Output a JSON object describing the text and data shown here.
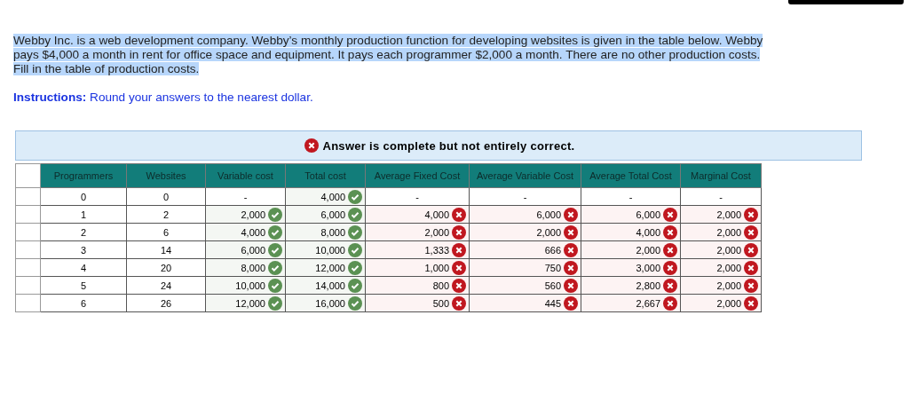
{
  "intro": {
    "text": "Webby Inc. is a web development company. Webby’s monthly production function for developing websites is given in the table below. Webby pays $4,000 a month in rent for office space and equipment. It pays each programmer $2,000 a month. There are no other production costs. Fill in the table of production costs.",
    "highlighted": true
  },
  "instructions": "**Instructions:** Round your answers to the nearest dollar.",
  "result_banner": {
    "text": "Answer is complete but not entirely correct.",
    "correct": false
  },
  "table": {
    "columns": [
      "Programmers",
      "Websites",
      "Variable cost",
      "Total cost",
      "Average Fixed Cost",
      "Average Variable Cost",
      "Average Total Cost",
      "Marginal Cost"
    ],
    "rows": [
      [
        {
          "value": "0",
          "kind": "given"
        },
        {
          "value": "0",
          "kind": "given"
        },
        {
          "value": "-",
          "kind": "given"
        },
        {
          "value": "4,000",
          "kind": "answer",
          "correct": true
        },
        {
          "value": "-",
          "kind": "given"
        },
        {
          "value": "-",
          "kind": "given"
        },
        {
          "value": "-",
          "kind": "given"
        },
        {
          "value": "-",
          "kind": "given"
        }
      ],
      [
        {
          "value": "1",
          "kind": "given"
        },
        {
          "value": "2",
          "kind": "given"
        },
        {
          "value": "2,000",
          "kind": "answer",
          "correct": true
        },
        {
          "value": "6,000",
          "kind": "answer",
          "correct": true
        },
        {
          "value": "4,000",
          "kind": "answer",
          "correct": false
        },
        {
          "value": "6,000",
          "kind": "answer",
          "correct": false
        },
        {
          "value": "6,000",
          "kind": "answer",
          "correct": false
        },
        {
          "value": "2,000",
          "kind": "answer",
          "correct": false
        }
      ],
      [
        {
          "value": "2",
          "kind": "given"
        },
        {
          "value": "6",
          "kind": "given"
        },
        {
          "value": "4,000",
          "kind": "answer",
          "correct": true
        },
        {
          "value": "8,000",
          "kind": "answer",
          "correct": true
        },
        {
          "value": "2,000",
          "kind": "answer",
          "correct": false
        },
        {
          "value": "2,000",
          "kind": "answer",
          "correct": false
        },
        {
          "value": "4,000",
          "kind": "answer",
          "correct": false
        },
        {
          "value": "2,000",
          "kind": "answer",
          "correct": false
        }
      ],
      [
        {
          "value": "3",
          "kind": "given"
        },
        {
          "value": "14",
          "kind": "given"
        },
        {
          "value": "6,000",
          "kind": "answer",
          "correct": true
        },
        {
          "value": "10,000",
          "kind": "answer",
          "correct": true
        },
        {
          "value": "1,333",
          "kind": "answer",
          "correct": false
        },
        {
          "value": "666",
          "kind": "answer",
          "correct": false
        },
        {
          "value": "2,000",
          "kind": "answer",
          "correct": false
        },
        {
          "value": "2,000",
          "kind": "answer",
          "correct": false
        }
      ],
      [
        {
          "value": "4",
          "kind": "given"
        },
        {
          "value": "20",
          "kind": "given"
        },
        {
          "value": "8,000",
          "kind": "answer",
          "correct": true
        },
        {
          "value": "12,000",
          "kind": "answer",
          "correct": true
        },
        {
          "value": "1,000",
          "kind": "answer",
          "correct": false
        },
        {
          "value": "750",
          "kind": "answer",
          "correct": false
        },
        {
          "value": "3,000",
          "kind": "answer",
          "correct": false
        },
        {
          "value": "2,000",
          "kind": "answer",
          "correct": false
        }
      ],
      [
        {
          "value": "5",
          "kind": "given"
        },
        {
          "value": "24",
          "kind": "given"
        },
        {
          "value": "10,000",
          "kind": "answer",
          "correct": true
        },
        {
          "value": "14,000",
          "kind": "answer",
          "correct": true
        },
        {
          "value": "800",
          "kind": "answer",
          "correct": false
        },
        {
          "value": "560",
          "kind": "answer",
          "correct": false
        },
        {
          "value": "2,800",
          "kind": "answer",
          "correct": false
        },
        {
          "value": "2,000",
          "kind": "answer",
          "correct": false
        }
      ],
      [
        {
          "value": "6",
          "kind": "given"
        },
        {
          "value": "26",
          "kind": "given"
        },
        {
          "value": "12,000",
          "kind": "answer",
          "correct": true
        },
        {
          "value": "16,000",
          "kind": "answer",
          "correct": true
        },
        {
          "value": "500",
          "kind": "answer",
          "correct": false
        },
        {
          "value": "445",
          "kind": "answer",
          "correct": false
        },
        {
          "value": "2,667",
          "kind": "answer",
          "correct": false
        },
        {
          "value": "2,000",
          "kind": "answer",
          "correct": false
        }
      ]
    ]
  }
}
